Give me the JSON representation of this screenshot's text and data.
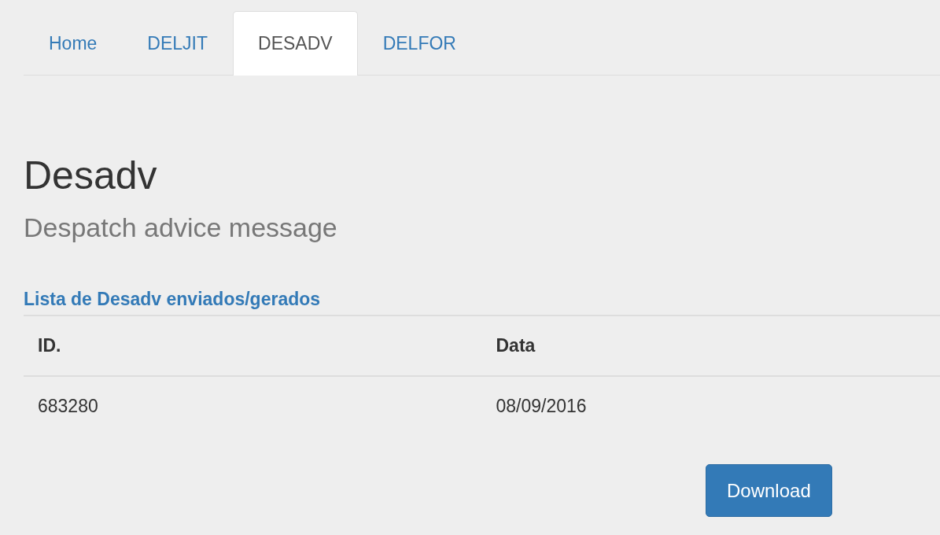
{
  "tabs": [
    {
      "label": "Home",
      "selected": false
    },
    {
      "label": "DELJIT",
      "selected": false
    },
    {
      "label": "DESADV",
      "selected": true
    },
    {
      "label": "DELFOR",
      "selected": false
    }
  ],
  "heading": "Desadv",
  "subheading": "Despatch advice message",
  "list_title": "Lista de Desadv enviados/gerados",
  "table": {
    "columns": [
      "ID.",
      "Data"
    ],
    "rows": [
      [
        "683280",
        "08/09/2016"
      ]
    ]
  },
  "buttons": [
    "Download"
  ]
}
